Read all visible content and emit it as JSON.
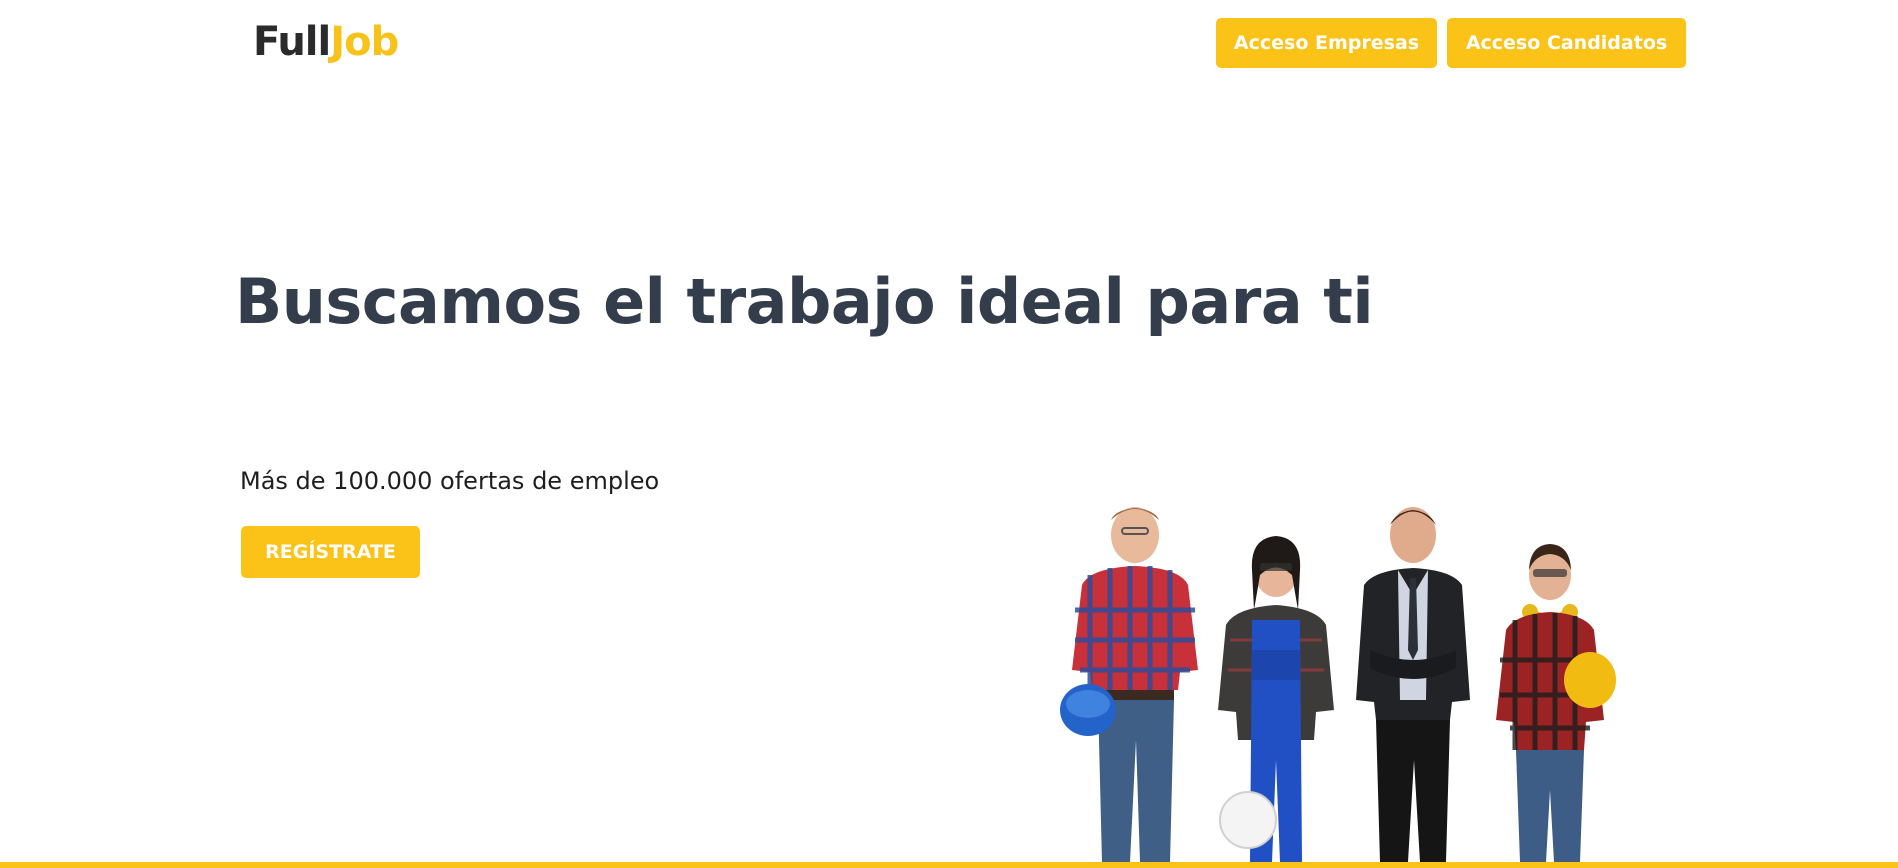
{
  "logo": {
    "part1": "Full",
    "part2": "Job"
  },
  "header": {
    "buttons": [
      {
        "label": "Acceso Empresas"
      },
      {
        "label": "Acceso Candidatos"
      }
    ]
  },
  "hero": {
    "title": "Buscamos el trabajo ideal para ti",
    "subtitle": "Más de 100.000 ofertas de empleo",
    "cta_label": "REGÍSTRATE"
  },
  "colors": {
    "accent": "#fbc318",
    "heading": "#343d4c",
    "logo_dark": "#2b2b2b"
  }
}
